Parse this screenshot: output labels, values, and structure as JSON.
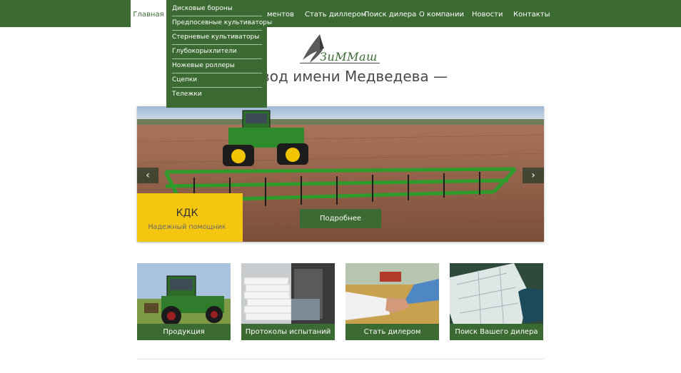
{
  "nav": {
    "items": [
      {
        "label": "Главная",
        "active": true
      },
      {
        "label": "ментов"
      },
      {
        "label": "Стать диллером"
      },
      {
        "label": "Поиск дилера"
      },
      {
        "label": "О компании"
      },
      {
        "label": "Новости"
      },
      {
        "label": "Контакты"
      }
    ]
  },
  "dropdown": {
    "items": [
      "Дисковые бороны",
      "Предпосевные культиваторы",
      "Стерневые культиваторы",
      "Глубокорыхлители",
      "Ножевые роллеры",
      "Сцепки",
      "Тележки"
    ]
  },
  "logo": {
    "text": "ЗиММаш"
  },
  "headline": "вод имени Медведева —",
  "slider": {
    "caption_title": "КДК",
    "caption_subtitle": "Надежный помощник",
    "more_label": "Подробнее",
    "prev_icon": "‹",
    "next_icon": "›"
  },
  "cards": [
    {
      "label": "Продукция"
    },
    {
      "label": "Протоколы испытаний"
    },
    {
      "label": "Стать дилером"
    },
    {
      "label": "Поиск Вашего дилера"
    }
  ],
  "colors": {
    "brand_green": "#3b6a32",
    "accent_yellow": "#f5c60f"
  }
}
